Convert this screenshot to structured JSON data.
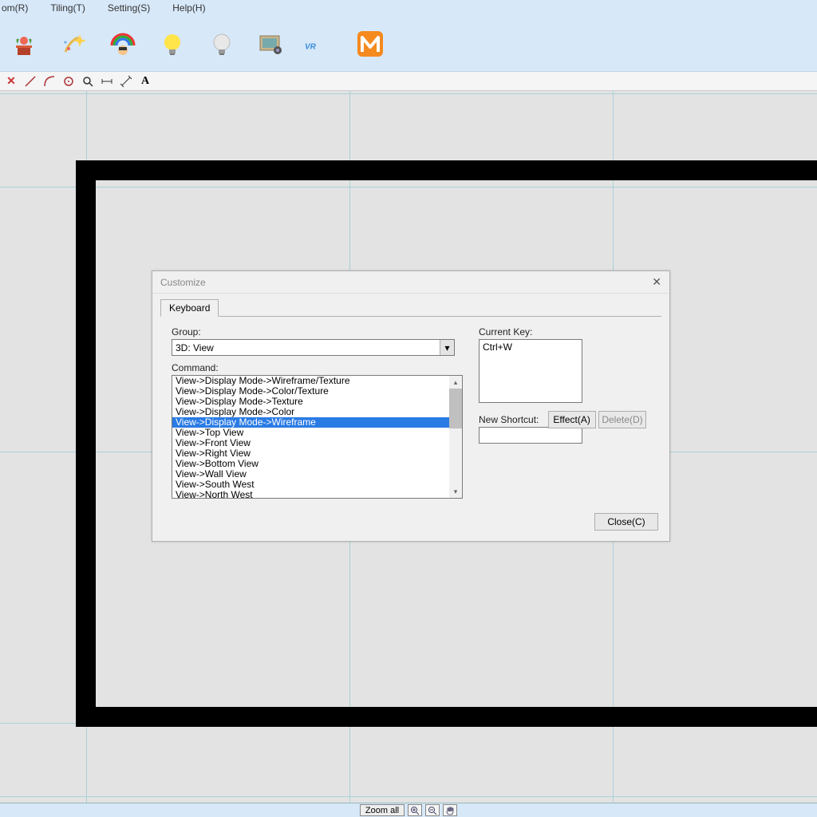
{
  "menus": {
    "m1": "om(R)",
    "m2": "Tiling(T)",
    "m3": "Setting(S)",
    "m4": "Help(H)"
  },
  "big_icons": [
    "flowerpot",
    "sparkle-star",
    "rainbow-head",
    "bulb-on",
    "bulb-off",
    "picture",
    "vr",
    "m-logo"
  ],
  "small_icons": [
    "x",
    "line",
    "arc",
    "circle",
    "magnifier",
    "ruler-h",
    "ruler-diag",
    "text-a"
  ],
  "dialog": {
    "title": "Customize",
    "tab": "Keyboard",
    "group_label": "Group:",
    "group_value": "3D:  View",
    "command_label": "Command:",
    "commands": [
      "View->Display Mode->Wireframe/Texture",
      "View->Display Mode->Color/Texture",
      "View->Display Mode->Texture",
      "View->Display Mode->Color",
      "View->Display Mode->Wireframe",
      "View->Top View",
      "View->Front View",
      "View->Right View",
      "View->Bottom View",
      "View->Wall View",
      "View->South West",
      "View->North West"
    ],
    "selected_index": 4,
    "current_key_label": "Current Key:",
    "current_key_value": "Ctrl+W",
    "new_shortcut_label": "New Shortcut:",
    "effect_btn": "Effect(A)",
    "delete_btn": "Delete(D)",
    "close_btn": "Close(C)"
  },
  "status": {
    "zoom_all": "Zoom all"
  }
}
